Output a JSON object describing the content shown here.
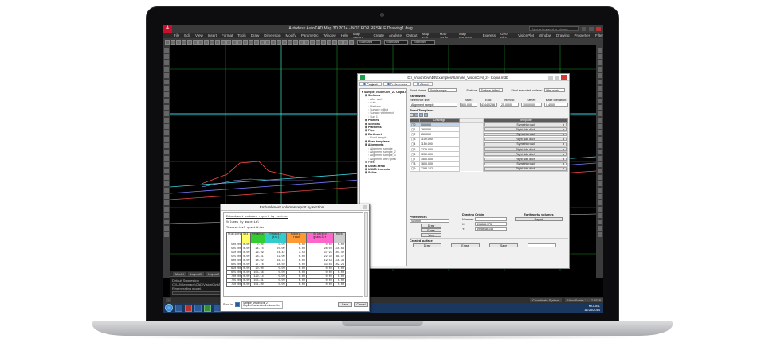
{
  "acad": {
    "title": "Autodesk AutoCAD Map 3D 2014 - NOT FOR RESALE   Drawing1.dwg",
    "logo": "A",
    "search_placeholder": "Type a keyword or phrase",
    "menu": [
      "File",
      "Edit",
      "View",
      "Insert",
      "Format",
      "Tools",
      "Draw",
      "Dimension",
      "Modify",
      "Parametric",
      "Window",
      "Help",
      "Map Setup",
      "Create",
      "Analyze",
      "Output",
      "Map Edit",
      "Map Tools",
      "Map Express",
      "Express",
      "Geo-Plot",
      "VisionPlot",
      "Window",
      "Drawing",
      "Properties",
      "Filter"
    ],
    "dropdowns": [
      "Standard",
      "Standard",
      "Standard"
    ],
    "tabs": [
      "Model",
      "Layout1",
      "Layout2"
    ],
    "cmd_lines": [
      "Default Suggestion",
      "C:\\UJ\\Geomaps\\CAD\\VisionCivil\\Projects\\CDs\\Samples",
      "Regenerating model."
    ],
    "status_right": [
      "Coordinate System",
      "View Scale: 1 : 17.5578"
    ],
    "clock_time": "MODEL",
    "clock_date": "11/25/2014"
  },
  "vision": {
    "title": "D:\\_VisionCivil\\Dt\\Examples\\Sample_VisionCivil_2 - Copia.mdb",
    "tabs": [
      "Project",
      "Preferences",
      "About"
    ],
    "tree": [
      {
        "label": "Sample_VisionCivil_2 - Copia.mdb",
        "level": 0,
        "bold": true
      },
      {
        "label": "Surfaces",
        "level": 1,
        "bold": true
      },
      {
        "label": "After work",
        "level": 2,
        "bold": false
      },
      {
        "label": "Auto",
        "level": 2,
        "bold": false
      },
      {
        "label": "Platform",
        "level": 2,
        "bold": false
      },
      {
        "label": "Surface drilled",
        "level": 2,
        "bold": false
      },
      {
        "label": "Surface with trench",
        "level": 2,
        "bold": false
      },
      {
        "label": "Surf 1",
        "level": 2,
        "bold": false
      },
      {
        "label": "Profiles",
        "level": 1,
        "bold": true
      },
      {
        "label": "Sections",
        "level": 1,
        "bold": true
      },
      {
        "label": "Platforms",
        "level": 1,
        "bold": true
      },
      {
        "label": "Pipe",
        "level": 1,
        "bold": true
      },
      {
        "label": "Earthwork",
        "level": 1,
        "bold": true
      },
      {
        "label": "Road sample",
        "level": 2,
        "bold": false
      },
      {
        "label": "Road templates",
        "level": 1,
        "bold": true
      },
      {
        "label": "Alignments",
        "level": 1,
        "bold": true
      },
      {
        "label": "Alignment sample",
        "level": 2,
        "bold": false
      },
      {
        "label": "Alignment sample_2",
        "level": 2,
        "bold": false
      },
      {
        "label": "Alignment sample_3",
        "level": 2,
        "bold": false
      },
      {
        "label": "Alignment with spiral",
        "level": 2,
        "bold": false
      },
      {
        "label": "Files",
        "level": 1,
        "bold": false
      },
      {
        "label": "UDMS aerial",
        "level": 1,
        "bold": true
      },
      {
        "label": "UDMS terrestrial",
        "level": 1,
        "bold": true
      },
      {
        "label": "Solids",
        "level": 1,
        "bold": true
      }
    ],
    "road_name_label": "Road Name:",
    "road_name": "Road sample",
    "surface_label": "Surface:",
    "surface": "Surface drilled",
    "final_label": "Final executed surface:",
    "final": "After work",
    "earthwork_title": "Earthwork",
    "ref_label": "Reference line:",
    "start_label": "Start:",
    "end_label": "End:",
    "interval_label": "Interval:",
    "offset_label": "Offset:",
    "base_label": "Base Elevation:",
    "ref_value": "Alignment sample",
    "start": "500.000",
    "end": "4144.0238",
    "interval": "25.0000",
    "offset": "100.0000",
    "base": "0.4000",
    "templates_title": "Road Templates",
    "col_chainage": "Chainage",
    "col_template": "Template",
    "rows": [
      {
        "n": "0",
        "chainage": "500.000",
        "template": "Symetric road",
        "sel": true
      },
      {
        "n": "1",
        "chainage": "790.000",
        "template": "Right side ditch",
        "sel": false
      },
      {
        "n": "2",
        "chainage": "850.000",
        "template": "Symetric road",
        "sel": false
      },
      {
        "n": "3",
        "chainage": "1100.000",
        "template": "Right side ditch",
        "sel": false
      },
      {
        "n": "4",
        "chainage": "1150.000",
        "template": "Symetric road",
        "sel": false
      },
      {
        "n": "5",
        "chainage": "1225.000",
        "template": "Right side ditch",
        "sel": false
      },
      {
        "n": "6",
        "chainage": "1250.000",
        "template": "Right side ditch",
        "sel": false
      },
      {
        "n": "7",
        "chainage": "1500.000",
        "template": "Right side ditch",
        "sel": false
      },
      {
        "n": "8",
        "chainage": "1600.000",
        "template": "Symetric road",
        "sel": false
      },
      {
        "n": "9",
        "chainage": "2283.102",
        "template": "Right side ditch",
        "sel": false
      }
    ],
    "prefs_title": "Preferences",
    "prefs_value": "Section",
    "drawing_origin_title": "Drawing Origin",
    "number_label": "Number:",
    "x_label": "X:",
    "y_label": "Y:",
    "x_value": "498868.173",
    "y_value": "4998648.148",
    "earthworks_vol_title": "Earthworks volumes",
    "report_btn": "Report",
    "draw_btn": "Draw",
    "erase_btn": "Erase",
    "view_btn": "View",
    "created_title": "Created surface",
    "created_draw": "Draw",
    "created_erase": "Erase",
    "created_save": "Save"
  },
  "report": {
    "title": "Embankment volumes report by section",
    "heading": "Embankment volumes report by section",
    "sub1": "Volumes by material",
    "sub2": "Theoretical quantities",
    "headers": [
      "Stations",
      "Soil",
      "Organic",
      "Organic (int)",
      "Subgrd. road",
      "Selected granular",
      "Rock"
    ],
    "rows": [
      [
        "500.00",
        "0.00",
        "0.00",
        "0.00",
        "0.00",
        "0.00",
        "0.00"
      ],
      [
        "525.00",
        "0.00",
        "24.74",
        "25.00",
        "0.00",
        "28.00",
        "110.63"
      ],
      [
        "550.00",
        "0.00",
        "26.69",
        "24.42",
        "7.50",
        "37.95",
        "101.42"
      ],
      [
        "575.00",
        "0.00",
        "28.41",
        "22.00",
        "0.00",
        "22.39",
        "88.17"
      ],
      [
        "600.00",
        "0.00",
        "18.02",
        "16.78",
        "0.00",
        "19.58",
        "116.38"
      ],
      [
        "625.00",
        "0.00",
        "27.78",
        "18.50",
        "0.00",
        "33.83",
        "102.21"
      ],
      [
        "650.00",
        "0.00",
        "20.00",
        "0.00",
        "0.00",
        "0.00",
        "0.00"
      ],
      [
        "675.00",
        "0.00",
        "105.56",
        "0.00",
        "0.00",
        "0.00",
        "0.00"
      ],
      [
        "700.00",
        "0.00",
        "120.14",
        "0.00",
        "0.00",
        "0.00",
        "0.00"
      ],
      [
        "725.00",
        "0.00",
        "105.81",
        "0.00",
        "0.00",
        "0.00",
        "0.00"
      ],
      [
        "750.00",
        "0.00",
        "101.00",
        "0.00",
        "0.00",
        "0.00",
        "0.00"
      ]
    ],
    "save_label": "Save in:",
    "file_name": "Sample_VisionCivil_2 - Copia.reportsections.volume.htm",
    "save_btn": "Save",
    "cancel_btn": "Cancel"
  },
  "colors": {
    "soil": "#ffff66",
    "organic": "#33cc33",
    "organic_int": "#33cccc",
    "subgrade": "#ff9933",
    "selected": "#ff66cc",
    "rock": "#cccccc"
  }
}
